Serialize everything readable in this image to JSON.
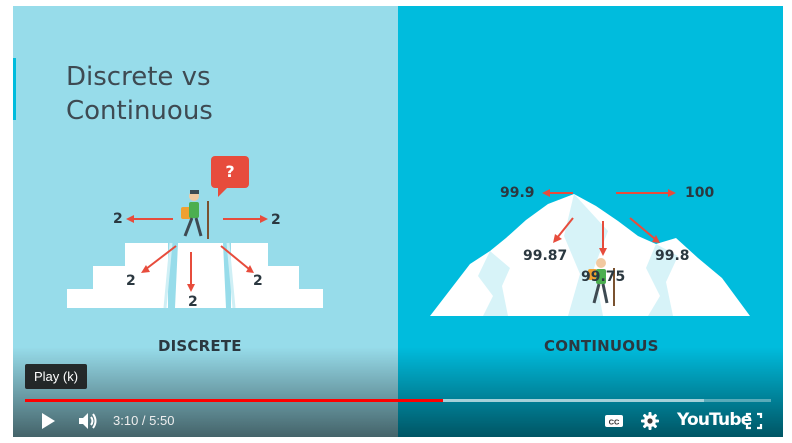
{
  "video": {
    "title_line1": "Discrete vs",
    "title_line2": "Continuous",
    "left_caption": "DISCRETE",
    "right_caption": "CONTINUOUS",
    "discrete_labels": {
      "left": "2",
      "right": "2",
      "lower_left": "2",
      "bottom": "2",
      "lower_right": "2",
      "question": "?"
    },
    "continuous_labels": {
      "left": "99.9",
      "right": "100",
      "lower_left": "99.87",
      "center": "99.75",
      "lower_right": "99.8"
    }
  },
  "player": {
    "tooltip": "Play (k)",
    "current_time": "3:10",
    "separator": " / ",
    "duration": "5:50",
    "brand": "YouTube",
    "progress_played_fraction": 0.56,
    "progress_loaded_fraction": 0.91,
    "accent_color": "#ff0000"
  }
}
